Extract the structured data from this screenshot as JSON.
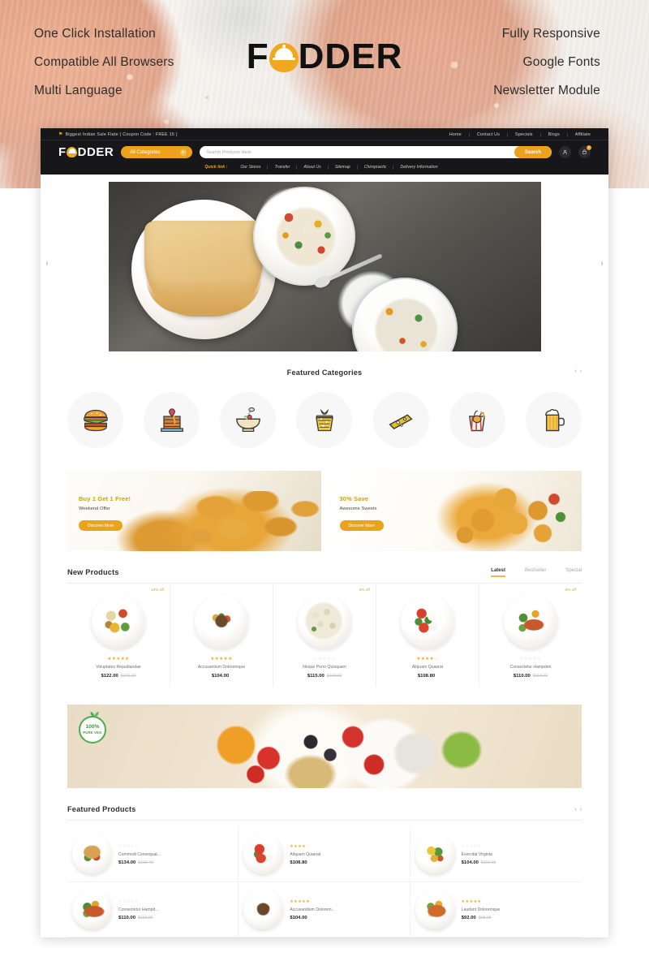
{
  "promo": {
    "brand": "FODDER",
    "features_left": [
      "One Click Installation",
      "Compatible All Browsers",
      "Multi Language"
    ],
    "features_right": [
      "Fully Responsive",
      "Google Fonts",
      "Newsletter Module"
    ]
  },
  "header": {
    "offer_text": "Biggest Indian Sale Flate ( Coupon Code : FREE 15 )",
    "top_links": [
      "Home",
      "Contact Us",
      "Specials",
      "Blogs",
      "Affiliate"
    ],
    "logo": "FODDER",
    "category_select": "All Categories",
    "search_placeholder": "Search Products Here",
    "search_value": "",
    "search_button": "Search",
    "cart_count": "0",
    "quicklink_label": "Quick link :",
    "quick_links": [
      "Our Stores",
      "Transfer",
      "About Us",
      "Sitemap",
      "Chiropractic",
      "Delivery Information"
    ]
  },
  "categories": {
    "title": "Featured Categories",
    "items": [
      {
        "name": "burger-category-icon"
      },
      {
        "name": "cake-category-icon"
      },
      {
        "name": "soup-bowl-category-icon"
      },
      {
        "name": "cupcake-category-icon"
      },
      {
        "name": "cheese-category-icon"
      },
      {
        "name": "noodle-box-category-icon"
      },
      {
        "name": "beer-category-icon"
      }
    ]
  },
  "banners": [
    {
      "title": "Buy 1 Get 1 Free!",
      "subtitle": "Weekend Offer",
      "button": "Discover More"
    },
    {
      "title": "30% Save",
      "subtitle": "Awesome Sweets",
      "button": "Discover More"
    }
  ],
  "new_products": {
    "title": "New Products",
    "tabs": [
      "Latest",
      "Bestseller",
      "Special"
    ],
    "active_tab": "Latest",
    "items": [
      {
        "discount": "13% off",
        "rating": 5,
        "name": "Voluptates Repudiandae",
        "price": "$122.00",
        "old_price": "$140.00"
      },
      {
        "discount": "",
        "rating": 5,
        "name": "Accusantium Doloremque",
        "price": "$104.00",
        "old_price": ""
      },
      {
        "discount": "3% off",
        "rating": 0,
        "name": "Neque Porro Quisquam",
        "price": "$115.00",
        "old_price": "$118.00"
      },
      {
        "discount": "",
        "rating": 4,
        "name": "Aliquam Quaerat",
        "price": "$108.80",
        "old_price": ""
      },
      {
        "discount": "8% off",
        "rating": 0,
        "name": "Consectetur Hampden",
        "price": "$110.00",
        "old_price": "$119.60"
      }
    ]
  },
  "mid_banner": {
    "badge_top": "100%",
    "badge_bottom": "PURE VEG"
  },
  "featured_products": {
    "title": "Featured Products",
    "items": [
      {
        "rating": 0,
        "name": "Commodi Consequat...",
        "price": "$134.00",
        "old_price": "$136.40"
      },
      {
        "rating": 4,
        "name": "Aliquam Quaerat",
        "price": "$108.80",
        "old_price": ""
      },
      {
        "rating": 0,
        "name": "Exercitat Virginia",
        "price": "$104.00",
        "old_price": "$116.00"
      },
      {
        "rating": 0,
        "name": "Consectetur Hampd...",
        "price": "$110.00",
        "old_price": "$119.60"
      },
      {
        "rating": 5,
        "name": "Accusandium Dolorem...",
        "price": "$104.00",
        "old_price": ""
      },
      {
        "rating": 5,
        "name": "Laudant Doloremque",
        "price": "$92.00",
        "old_price": "$98.00"
      }
    ]
  },
  "icons": {
    "prev": "‹",
    "next": "›",
    "flame": "⚑",
    "caret_down": "▾",
    "user": "user-icon",
    "cart": "cart-icon"
  },
  "colors": {
    "accent": "#eda21c",
    "dark": "#17171a",
    "star_on": "#f3a81d",
    "star_off": "#d6d6d6"
  }
}
